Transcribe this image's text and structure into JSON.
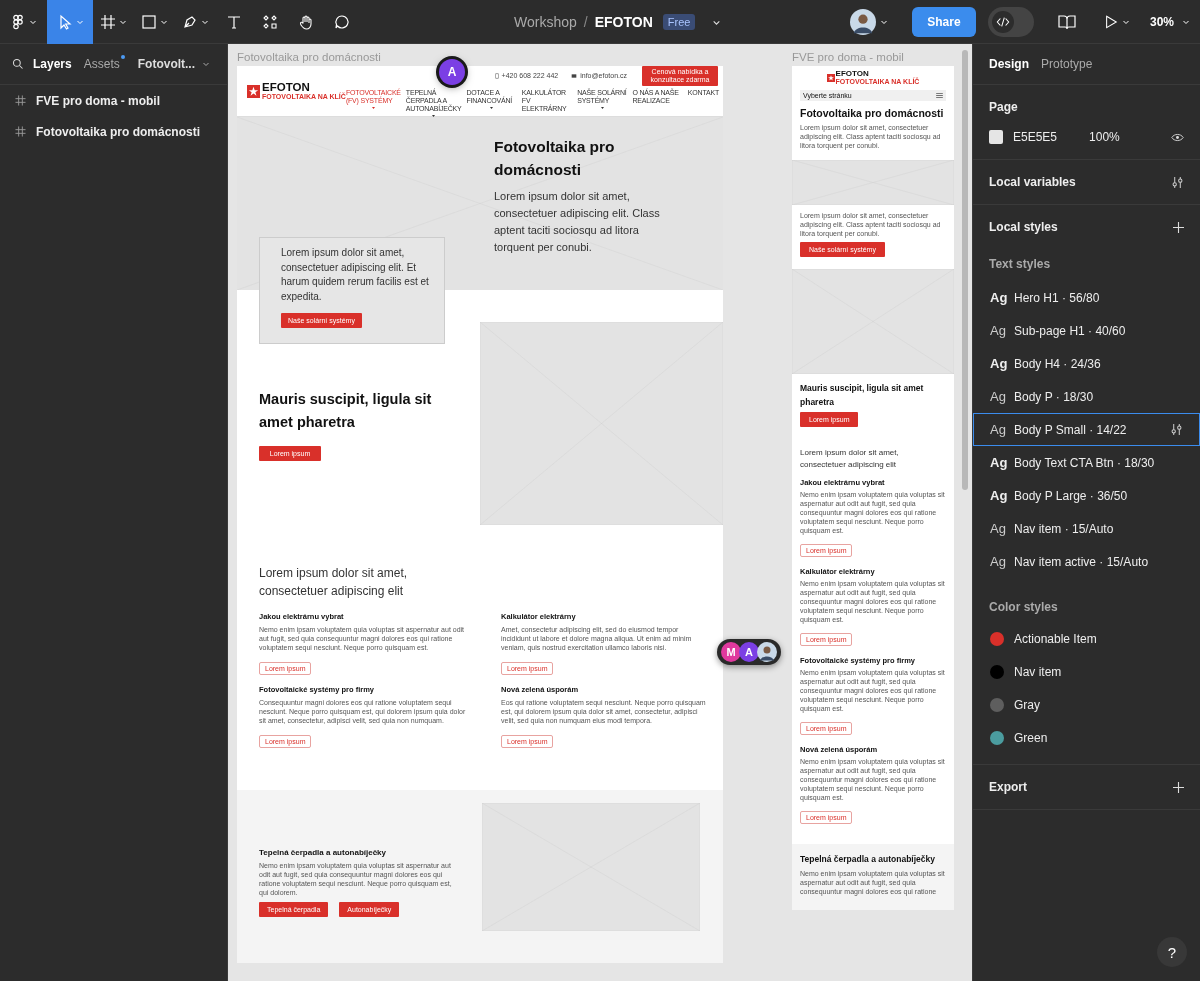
{
  "toolbar": {
    "tools": [
      {
        "kind": "main-menu",
        "selected": false
      },
      {
        "kind": "move",
        "selected": true
      },
      {
        "kind": "frame",
        "selected": false
      },
      {
        "kind": "rectangle",
        "selected": false
      },
      {
        "kind": "pen",
        "selected": false
      },
      {
        "kind": "text",
        "selected": false
      },
      {
        "kind": "resources",
        "selected": false
      },
      {
        "kind": "hand",
        "selected": false
      },
      {
        "kind": "comment",
        "selected": false
      }
    ],
    "dev_mode": false,
    "project": "Workshop",
    "separator": "/",
    "file": "EFOTON",
    "plan": "Free",
    "share": "Share",
    "zoom": "30%"
  },
  "left_panel": {
    "tabs": [
      {
        "label": "Layers",
        "selected": true,
        "dot": false
      },
      {
        "label": "Assets",
        "selected": false,
        "dot": true
      }
    ],
    "page_select": "Fotovolt...",
    "layers": [
      {
        "name": "FVE pro doma - mobil"
      },
      {
        "name": "Fotovoltaika pro domácnosti"
      }
    ]
  },
  "desktop": {
    "frame_label": "Fotovoltaika pro domácnosti",
    "logo": {
      "name": "EFOTON",
      "tagline": "FOTOVOLTAIKA NA KLÍČ"
    },
    "phone": "+420 608 222 442",
    "email": "info@efoton.cz",
    "cta": "Cenová nabídka a konzultace zdarma",
    "nav": [
      {
        "label": "FOTOVOLTAICKÉ (FV) SYSTÉMY",
        "selected": true,
        "dropdown": true
      },
      {
        "label": "TEPELNÁ ČERPADLA A AUTONABÍJEČKY",
        "selected": false,
        "dropdown": true
      },
      {
        "label": "DOTACE A FINANCOVÁNÍ",
        "selected": false,
        "dropdown": true
      },
      {
        "label": "KALKULÁTOR FV ELEKTRÁRNY",
        "selected": false,
        "dropdown": false
      },
      {
        "label": "NAŠE SOLÁRNÍ SYSTÉMY",
        "selected": false,
        "dropdown": true
      },
      {
        "label": "O NÁS A NAŠE REALIZACE",
        "selected": false,
        "dropdown": false
      },
      {
        "label": "KONTAKT",
        "selected": false,
        "dropdown": false
      }
    ],
    "hero": {
      "title": "Fotovoltaika pro domácnosti",
      "text": "Lorem ipsum dolor sit amet, consectetuer adipiscing elit. Class aptent taciti sociosqu ad litora torquent per conubi.",
      "card_text": "Lorem ipsum dolor sit amet, consectetuer adipiscing elit. Et harum quidem rerum facilis est et expedita.",
      "card_button": "Naše solární systémy"
    },
    "feature": {
      "title": "Mauris suscipit, ligula sit amet pharetra",
      "button": "Lorem ipsum"
    },
    "intro": "Lorem ipsum dolor sit amet, consectetuer adipiscing elit",
    "cards": [
      {
        "title": "Jakou elektrárnu vybrat",
        "text": "Nemo enim ipsam voluptatem quia voluptas sit aspernatur aut odit aut fugit, sed quia consequuntur magni dolores eos qui ratione voluptatem sequi nesciunt. Neque porro quisquam est.",
        "button": "Lorem ipsum"
      },
      {
        "title": "Kalkulátor elektrárny",
        "text": "Amet, consectetur adipiscing elit, sed do eiusmod tempor incididunt ut labore et dolore magna aliqua. Ut enim ad minim veniam, quis nostrud exercitation ullamco laboris nisi.",
        "button": "Lorem ipsum"
      },
      {
        "title": "Fotovoltaické systémy pro firmy",
        "text": "Consequuntur magni dolores eos qui ratione voluptatem sequi nesciunt. Neque porro quisquam est, qui dolorem ipsum quia dolor sit amet, consectetur, adipisci velit, sed quia non numquam.",
        "button": "Lorem ipsum"
      },
      {
        "title": "Nová zelená úsporám",
        "text": "Eos qui ratione voluptatem sequi nesciunt. Neque porro quisquam est, qui dolorem ipsum quia dolor sit amet, consectetur, adipisci velit, sed quia non numquam eius modi tempora.",
        "button": "Lorem ipsum"
      }
    ],
    "bottom": {
      "title": "Tepelná čerpadla a autonabíječky",
      "text": "Nemo enim ipsam voluptatem quia voluptas sit aspernatur aut odit aut fugit, sed quia consequuntur magni dolores eos qui ratione voluptatem sequi nesciunt. Neque porro quisquam est, qui dolorem.",
      "buttons": [
        "Tepelná čerpadla",
        "Autonabíječky"
      ]
    }
  },
  "mobile": {
    "frame_label": "FVE pro doma - mobil",
    "logo": {
      "name": "EFOTON",
      "tagline": "FOTOVOLTAIKA NA KLÍČ"
    },
    "page_select": "Vyberte stránku",
    "title": "Fotovoltaika pro domácnosti",
    "text": "Lorem ipsum dolor sit amet, consectetuer adipiscing elit. Class aptent taciti sociosqu ad litora torquent per conubi.",
    "text_2": "Lorem ipsum dolor sit amet, consectetuer adipiscing elit. Class aptent taciti sociosqu ad litora torquent per conubi.",
    "button": "Naše solární systémy",
    "feature_title": "Mauris suscipit, ligula sit amet pharetra",
    "feature_button": "Lorem ipsum",
    "intro": "Lorem ipsum dolor sit amet, consectetuer adipiscing elit",
    "cards": [
      {
        "title": "Jakou elektrárnu vybrat",
        "text": "Nemo enim ipsam voluptatem quia voluptas sit aspernatur aut odit aut fugit, sed quia consequuntur magni dolores eos qui ratione voluptatem sequi nesciunt. Neque porro quisquam est.",
        "button": "Lorem ipsum"
      },
      {
        "title": "Kalkulátor elektrárny",
        "text": "Nemo enim ipsam voluptatem quia voluptas sit aspernatur aut odit aut fugit, sed quia consequuntur magni dolores eos qui ratione voluptatem sequi nesciunt. Neque porro quisquam est.",
        "button": "Lorem ipsum"
      },
      {
        "title": "Fotovoltaické systémy pro firmy",
        "text": "Nemo enim ipsam voluptatem quia voluptas sit aspernatur aut odit aut fugit, sed quia consequuntur magni dolores eos qui ratione voluptatem sequi nesciunt. Neque porro quisquam est.",
        "button": "Lorem ipsum"
      },
      {
        "title": "Nová zelená úsporám",
        "text": "Nemo enim ipsam voluptatem quia voluptas sit aspernatur aut odit aut fugit, sed quia consequuntur magni dolores eos qui ratione voluptatem sequi nesciunt. Neque porro quisquam est.",
        "button": "Lorem ipsum"
      }
    ],
    "bottom_title": "Tepelná čerpadla a autonabíječky",
    "bottom_text": "Nemo enim ipsam voluptatem quia voluptas sit aspernatur aut odit aut fugit, sed quia consequuntur magni dolores eos qui ratione"
  },
  "cursor": {
    "label": "A",
    "color": "#7b3fe4"
  },
  "collaborators": [
    {
      "label": "M",
      "color": "#e0399e"
    },
    {
      "label": "A",
      "color": "#7b3fe4"
    }
  ],
  "right_panel": {
    "tabs": [
      {
        "label": "Design",
        "selected": true
      },
      {
        "label": "Prototype",
        "selected": false
      }
    ],
    "page": {
      "heading": "Page",
      "color": "E5E5E5",
      "opacity": "100%"
    },
    "local_variables": "Local variables",
    "local_styles": "Local styles",
    "text_styles_heading": "Text styles",
    "text_styles": [
      {
        "sample": "Ag",
        "label": "Hero H1 · 56/80",
        "bold": true,
        "selected": false
      },
      {
        "sample": "Ag",
        "label": "Sub-page H1 · 40/60",
        "bold": false,
        "selected": false
      },
      {
        "sample": "Ag",
        "label": "Body H4 · 24/36",
        "bold": true,
        "selected": false
      },
      {
        "sample": "Ag",
        "label": "Body P · 18/30",
        "bold": false,
        "selected": false
      },
      {
        "sample": "Ag",
        "label": "Body P Small · 14/22",
        "bold": false,
        "selected": true
      },
      {
        "sample": "Ag",
        "label": "Body Text CTA Btn · 18/30",
        "bold": true,
        "selected": false
      },
      {
        "sample": "Ag",
        "label": "Body P Large · 36/50",
        "bold": true,
        "selected": false
      },
      {
        "sample": "Ag",
        "label": "Nav item · 15/Auto",
        "bold": false,
        "selected": false
      },
      {
        "sample": "Ag",
        "label": "Nav item active · 15/Auto",
        "bold": false,
        "selected": false
      }
    ],
    "color_styles_heading": "Color styles",
    "color_styles": [
      {
        "label": "Actionable Item",
        "color": "#d9302a"
      },
      {
        "label": "Nav item",
        "color": "#000000"
      },
      {
        "label": "Gray",
        "color": "#5e5e5e"
      },
      {
        "label": "Green",
        "color": "#4b9c9f"
      }
    ],
    "export": "Export"
  },
  "help": "?"
}
